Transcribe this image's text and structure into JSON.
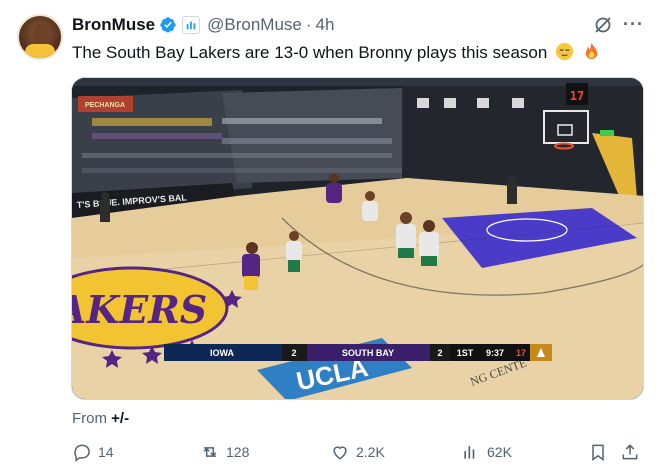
{
  "author": {
    "name": "BronMuse",
    "handle": "@BronMuse",
    "separator": "·",
    "time": "4h"
  },
  "tweet": {
    "text": "The South Bay Lakers are 13-0 when Bronny plays this season"
  },
  "video": {
    "court_ad": "PECHANGA",
    "banner_left": "T'S BLUE. IMPROV'S BAL",
    "scoreboard": {
      "team1": "IOWA",
      "score1": "2",
      "team2": "SOUTH BAY",
      "score2": "2",
      "period": "1ST",
      "clock": "9:37",
      "shot_clock": "17"
    },
    "floor_logo": "AKERS",
    "floor_text": "UCLA",
    "floor_text2": "NG CENTE",
    "shot_clock_top": "17"
  },
  "footer": {
    "from_label": "From",
    "from_value": "+/-"
  },
  "actions": {
    "replies": "14",
    "reposts": "128",
    "likes": "2.2K",
    "views": "62K"
  }
}
